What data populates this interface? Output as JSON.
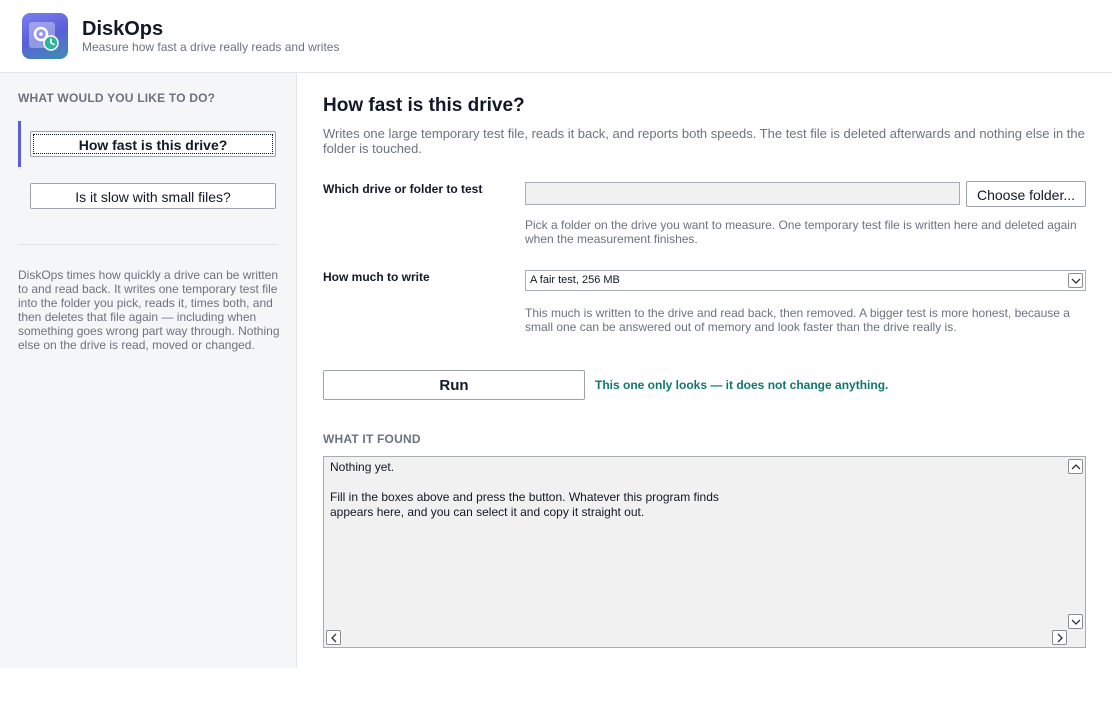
{
  "app": {
    "title": "DiskOps",
    "subtitle": "Measure how fast a drive really reads and writes",
    "logo_icon": "disk-clock-icon",
    "accent": "#5b5fd6"
  },
  "sidebar": {
    "heading": "WHAT WOULD YOU LIKE TO DO?",
    "items": [
      {
        "label": "How fast is this drive?",
        "active": true
      },
      {
        "label": "Is it slow with small files?",
        "active": false
      }
    ],
    "description": "DiskOps times how quickly a drive can be written to and read back. It writes one temporary test file into the folder you pick, reads it, times both, and then deletes that file again — including when something goes wrong part way through. Nothing else on the drive is read, moved or changed."
  },
  "main": {
    "title": "How fast is this drive?",
    "description": "Writes one large temporary test file, reads it back, and reports both speeds. The test file is deleted afterwards and nothing else in the folder is touched.",
    "folder": {
      "label": "Which drive or folder to test",
      "value": "",
      "button_label": "Choose folder...",
      "hint": "Pick a folder on the drive you want to measure. One temporary test file is written here and deleted again when the measurement finishes."
    },
    "size": {
      "label": "How much to write",
      "selected": "A fair test, 256 MB",
      "hint": "This much is written to the drive and read back, then removed. A bigger test is more honest, because a small one can be answered out of memory and look faster than the drive really is."
    },
    "run": {
      "button_label": "Run",
      "note": "This one only looks — it does not change anything.",
      "note_color": "#0f766e"
    },
    "results": {
      "heading": "WHAT IT FOUND",
      "text": "Nothing yet.\n\nFill in the boxes above and press the button. Whatever this program finds\nappears here, and you can select it and copy it straight out."
    }
  }
}
